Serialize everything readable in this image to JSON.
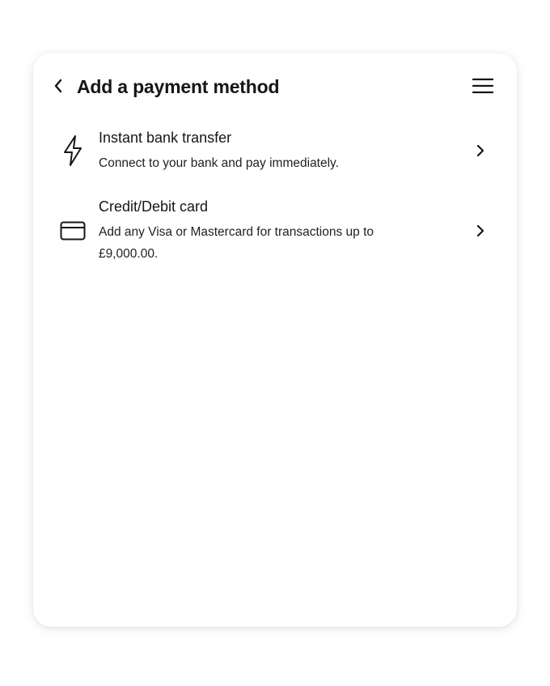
{
  "header": {
    "title": "Add a payment method",
    "back_icon": "chevron-left-icon",
    "menu_icon": "hamburger-menu-icon"
  },
  "payment_options": [
    {
      "icon": "lightning-bolt-icon",
      "title": "Instant bank transfer",
      "description": "Connect to your bank and pay immediately."
    },
    {
      "icon": "credit-card-icon",
      "title": "Credit/Debit card",
      "description": "Add any Visa or Mastercard for transactions up to £9,000.00."
    }
  ],
  "colors": {
    "text": "#161616",
    "background": "#ffffff"
  }
}
